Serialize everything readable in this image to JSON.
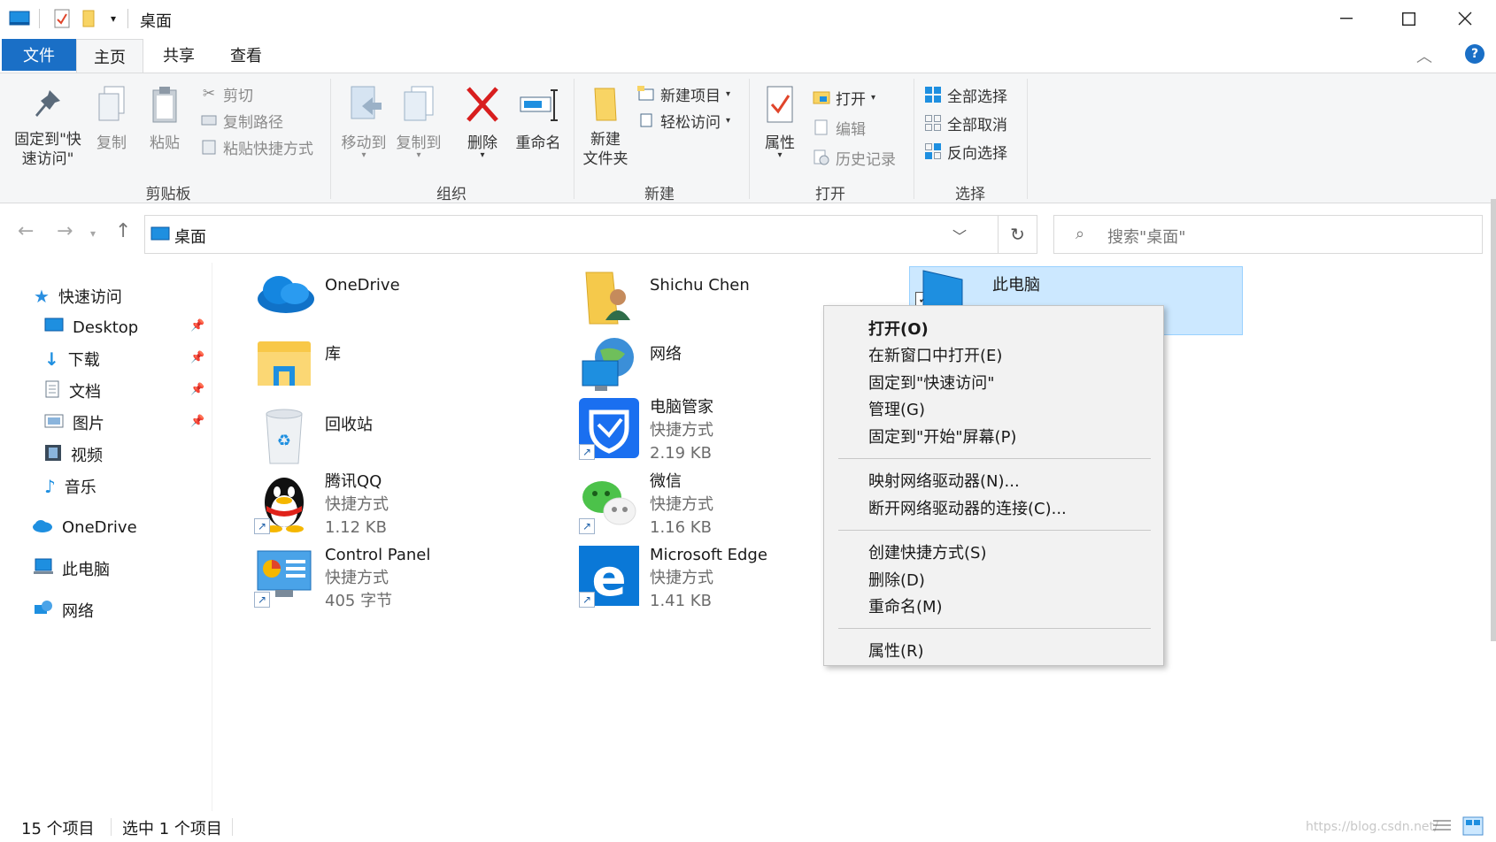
{
  "window": {
    "title": "桌面",
    "accent_color": "#1a6fc6"
  },
  "ribbon_tabs": [
    "文件",
    "主页",
    "共享",
    "查看"
  ],
  "ribbon": {
    "clipboard": {
      "label": "剪贴板",
      "pin": "固定到\"快\n速访问\"",
      "copy": "复制",
      "paste": "粘贴",
      "cut": "剪切",
      "copy_path": "复制路径",
      "paste_shortcut": "粘贴快捷方式"
    },
    "organize": {
      "label": "组织",
      "move_to": "移动到",
      "copy_to": "复制到",
      "delete": "删除",
      "rename": "重命名"
    },
    "new": {
      "label": "新建",
      "new_folder": "新建\n文件夹",
      "new_item": "新建项目",
      "easy_access": "轻松访问"
    },
    "open": {
      "label": "打开",
      "properties": "属性",
      "open": "打开",
      "edit": "编辑",
      "history": "历史记录"
    },
    "select": {
      "label": "选择",
      "select_all": "全部选择",
      "select_none": "全部取消",
      "invert": "反向选择"
    }
  },
  "address": {
    "path": "桌面",
    "search_placeholder": "搜索\"桌面\""
  },
  "sidebar": {
    "quick_access": "快速访问",
    "items": [
      {
        "label": "Desktop",
        "icon": "desktop-icon",
        "pinned": true
      },
      {
        "label": "下载",
        "icon": "download-icon",
        "pinned": true
      },
      {
        "label": "文档",
        "icon": "document-icon",
        "pinned": true
      },
      {
        "label": "图片",
        "icon": "picture-icon",
        "pinned": true
      },
      {
        "label": "视频",
        "icon": "video-icon",
        "pinned": false
      },
      {
        "label": "音乐",
        "icon": "music-icon",
        "pinned": false
      }
    ],
    "onedrive": "OneDrive",
    "this_pc": "此电脑",
    "network": "网络"
  },
  "files": [
    {
      "name": "OneDrive",
      "icon": "onedrive-icon"
    },
    {
      "name": "Shichu Chen",
      "icon": "user-folder-icon"
    },
    {
      "name": "此电脑",
      "icon": "this-pc-icon",
      "selected": true
    },
    {
      "name": "库",
      "icon": "library-folder-icon"
    },
    {
      "name": "网络",
      "icon": "network-globe-icon"
    },
    {
      "name": "回收站",
      "icon": "recycle-bin-icon"
    },
    {
      "name": "电脑管家",
      "type": "快捷方式",
      "size": "2.19 KB",
      "icon": "pc-manager-icon"
    },
    {
      "name": "腾讯QQ",
      "type": "快捷方式",
      "size": "1.12 KB",
      "icon": "qq-penguin-icon"
    },
    {
      "name": "微信",
      "type": "快捷方式",
      "size": "1.16 KB",
      "icon": "wechat-icon"
    },
    {
      "name": "Control Panel",
      "type": "快捷方式",
      "size": "405 字节",
      "icon": "control-panel-icon"
    },
    {
      "name": "Microsoft Edge",
      "type": "快捷方式",
      "size": "1.41 KB",
      "icon": "edge-icon"
    }
  ],
  "context_menu": {
    "open": "打开(O)",
    "open_new_window": "在新窗口中打开(E)",
    "pin_quick_access": "固定到\"快速访问\"",
    "manage": "管理(G)",
    "pin_start": "固定到\"开始\"屏幕(P)",
    "map_drive": "映射网络驱动器(N)...",
    "disconnect_drive": "断开网络驱动器的连接(C)...",
    "create_shortcut": "创建快捷方式(S)",
    "delete": "删除(D)",
    "rename": "重命名(M)",
    "properties": "属性(R)"
  },
  "status": {
    "count": "15 个项目",
    "selected": "选中 1 个项目",
    "watermark": "https://blog.csdn.net/"
  }
}
